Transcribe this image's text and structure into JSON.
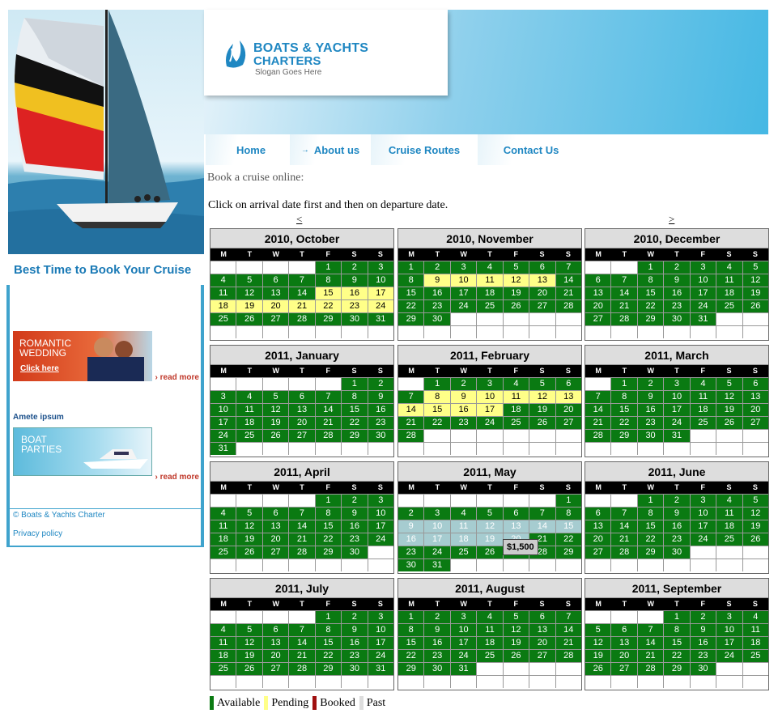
{
  "brand": {
    "line1": "BOATS & YACHTS",
    "line2": "CHARTERS",
    "slogan": "Slogan Goes Here"
  },
  "nav": {
    "home": "Home",
    "about": "About us",
    "routes": "Cruise Routes",
    "contact": "Contact Us"
  },
  "sidebar": {
    "title": "Best Time to Book Your Cruise",
    "promo1_line1": "ROMANTIC",
    "promo1_line2": "WEDDING",
    "promo1_click": "Click here",
    "read_more": "read more",
    "heading": "Amete ipsum",
    "promo2_line1": "BOAT",
    "promo2_line2": "PARTIES",
    "copyright": "© Boats & Yachts Charter",
    "privacy": "Privacy policy"
  },
  "booking": {
    "intro": "Book a cruise online:",
    "instruction": "Click on arrival date first and then on departure date.",
    "prev": "<",
    "next": ">",
    "tooltip": "$1,500"
  },
  "weekdays": [
    "M",
    "T",
    "W",
    "T",
    "F",
    "S",
    "S"
  ],
  "legend": {
    "available": "Available",
    "pending": "Pending",
    "booked": "Booked",
    "past": "Past"
  },
  "colors": {
    "available": "#0a7a12",
    "pending": "#ffff88",
    "booked": "#a01010",
    "past": "#dddddd",
    "selected": "#a6ccd0",
    "accent": "#1f87c2"
  },
  "calendars": [
    {
      "title": "2010, October",
      "offset": 4,
      "days": 31,
      "pending": [
        15,
        16,
        17,
        18,
        19,
        20,
        21,
        22,
        23,
        24
      ]
    },
    {
      "title": "2010, November",
      "offset": 0,
      "days": 30,
      "pending": [
        9,
        10,
        11,
        12,
        13
      ]
    },
    {
      "title": "2010, December",
      "offset": 2,
      "days": 31
    },
    {
      "title": "2011, January",
      "offset": 5,
      "days": 31
    },
    {
      "title": "2011, February",
      "offset": 1,
      "days": 28,
      "pending": [
        8,
        9,
        10,
        11,
        12,
        13,
        14,
        15,
        16,
        17
      ]
    },
    {
      "title": "2011, March",
      "offset": 1,
      "days": 31
    },
    {
      "title": "2011, April",
      "offset": 4,
      "days": 30
    },
    {
      "title": "2011, May",
      "offset": 6,
      "days": 31,
      "selected": [
        9,
        10,
        11,
        12,
        13,
        14,
        15,
        16,
        17,
        18,
        19,
        20
      ]
    },
    {
      "title": "2011, June",
      "offset": 2,
      "days": 30
    },
    {
      "title": "2011, July",
      "offset": 4,
      "days": 31
    },
    {
      "title": "2011, August",
      "offset": 0,
      "days": 31
    },
    {
      "title": "2011, September",
      "offset": 3,
      "days": 30
    }
  ]
}
